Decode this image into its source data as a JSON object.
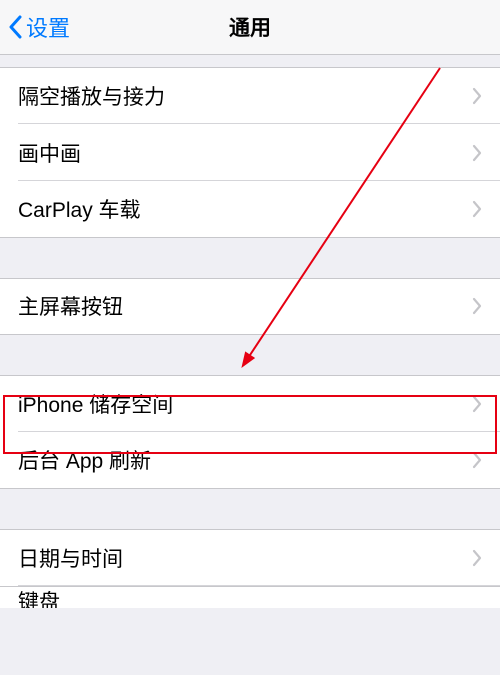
{
  "nav": {
    "back_label": "设置",
    "title": "通用"
  },
  "rows": {
    "airplay": "隔空播放与接力",
    "pip": "画中画",
    "carplay": "CarPlay 车载",
    "homebtn": "主屏幕按钮",
    "storage": "iPhone 储存空间",
    "bgrefresh": "后台 App 刷新",
    "datetime": "日期与时间",
    "keyboard": "键盘"
  }
}
